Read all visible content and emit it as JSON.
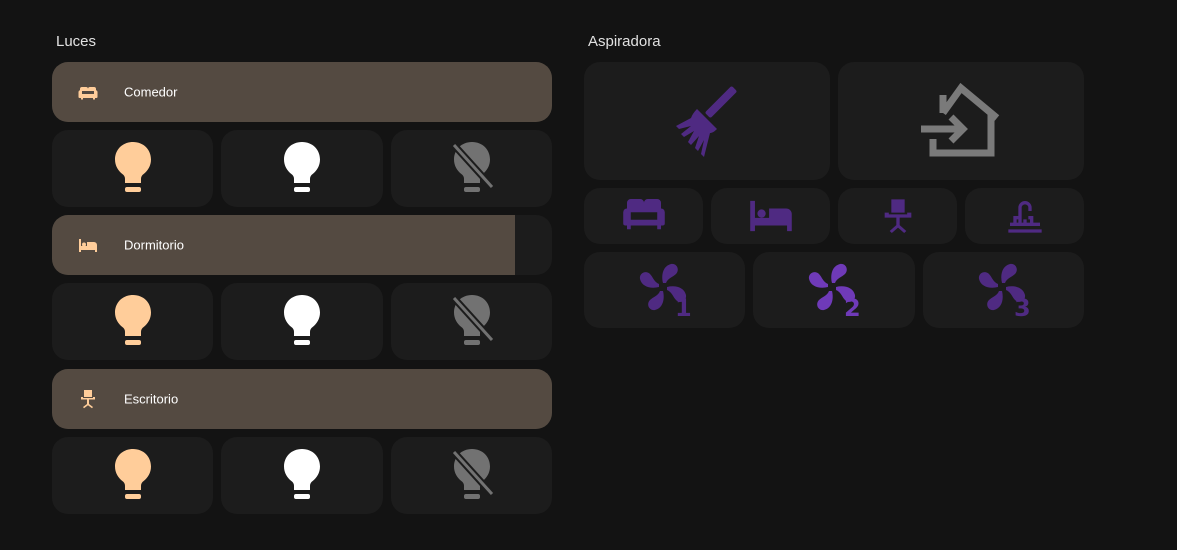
{
  "lights": {
    "title": "Luces",
    "rooms": [
      {
        "name": "Comedor",
        "icon": "sofa-icon",
        "brightness": 1.0
      },
      {
        "name": "Dormitorio",
        "icon": "bed-icon",
        "brightness": 0.925
      },
      {
        "name": "Escritorio",
        "icon": "desk-chair-icon",
        "brightness": 1.0
      }
    ],
    "presets": [
      "warm-bulb-icon",
      "white-bulb-icon",
      "bulb-off-icon"
    ]
  },
  "vacuum": {
    "title": "Aspiradora",
    "actions": [
      "broom-icon",
      "home-return-icon"
    ],
    "rooms": [
      "sofa-icon",
      "bed-icon",
      "desk-chair-icon",
      "faucet-icon"
    ],
    "fan_speeds": [
      "1",
      "2",
      "3"
    ]
  },
  "colors": {
    "background": "#131313",
    "card": "#1c1c1c",
    "room_fill": "#544a41",
    "warm_light": "#ffcd9a",
    "white_light": "#ffffff",
    "off_light": "#727272",
    "purple": "#4f2a82",
    "purple_bright": "#6f3ab8",
    "home_gray": "#7a7a7a"
  }
}
